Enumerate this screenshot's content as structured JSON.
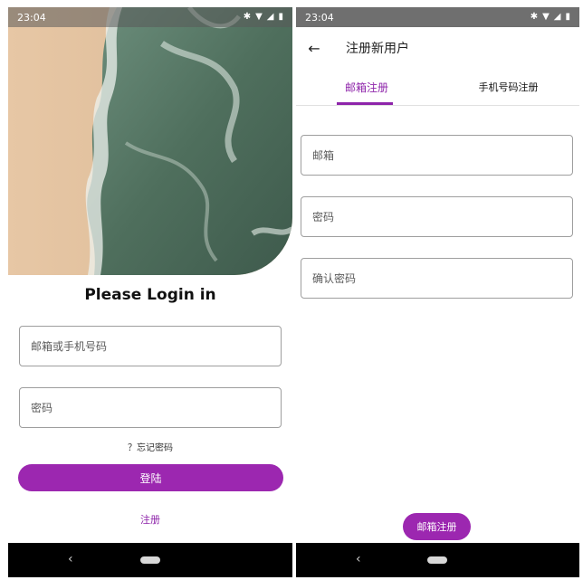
{
  "status_bar": {
    "time": "23:04"
  },
  "login": {
    "title": "Please Login in",
    "username_placeholder": "邮箱或手机号码",
    "password_placeholder": "密码",
    "forgot_password": "？忘记密码",
    "login_button": "登陆",
    "register_link": "注册"
  },
  "register": {
    "title": "注册新用户",
    "tabs": [
      {
        "label": "邮箱注册",
        "selected": true
      },
      {
        "label": "手机号码注册",
        "selected": false
      }
    ],
    "email_placeholder": "邮箱",
    "password_placeholder": "密码",
    "confirm_placeholder": "确认密码",
    "submit_button": "邮箱注册"
  },
  "colors": {
    "accent": "#9c27b0",
    "accent_text": "#8e24aa"
  },
  "icons": {
    "status": [
      "bluetooth-icon",
      "wifi-icon",
      "signal-icon",
      "battery-icon"
    ],
    "app_bar": "back-arrow-icon",
    "nav": [
      "nav-back-icon",
      "nav-home-pill"
    ]
  }
}
